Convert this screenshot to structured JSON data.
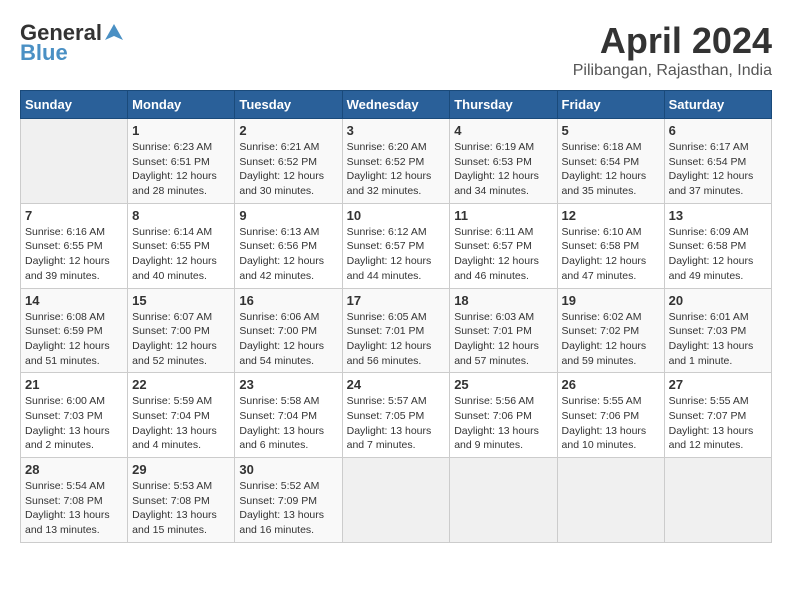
{
  "header": {
    "logo_general": "General",
    "logo_blue": "Blue",
    "title": "April 2024",
    "subtitle": "Pilibangan, Rajasthan, India"
  },
  "calendar": {
    "headers": [
      "Sunday",
      "Monday",
      "Tuesday",
      "Wednesday",
      "Thursday",
      "Friday",
      "Saturday"
    ],
    "weeks": [
      [
        {
          "day": "",
          "info": ""
        },
        {
          "day": "1",
          "info": "Sunrise: 6:23 AM\nSunset: 6:51 PM\nDaylight: 12 hours\nand 28 minutes."
        },
        {
          "day": "2",
          "info": "Sunrise: 6:21 AM\nSunset: 6:52 PM\nDaylight: 12 hours\nand 30 minutes."
        },
        {
          "day": "3",
          "info": "Sunrise: 6:20 AM\nSunset: 6:52 PM\nDaylight: 12 hours\nand 32 minutes."
        },
        {
          "day": "4",
          "info": "Sunrise: 6:19 AM\nSunset: 6:53 PM\nDaylight: 12 hours\nand 34 minutes."
        },
        {
          "day": "5",
          "info": "Sunrise: 6:18 AM\nSunset: 6:54 PM\nDaylight: 12 hours\nand 35 minutes."
        },
        {
          "day": "6",
          "info": "Sunrise: 6:17 AM\nSunset: 6:54 PM\nDaylight: 12 hours\nand 37 minutes."
        }
      ],
      [
        {
          "day": "7",
          "info": "Sunrise: 6:16 AM\nSunset: 6:55 PM\nDaylight: 12 hours\nand 39 minutes."
        },
        {
          "day": "8",
          "info": "Sunrise: 6:14 AM\nSunset: 6:55 PM\nDaylight: 12 hours\nand 40 minutes."
        },
        {
          "day": "9",
          "info": "Sunrise: 6:13 AM\nSunset: 6:56 PM\nDaylight: 12 hours\nand 42 minutes."
        },
        {
          "day": "10",
          "info": "Sunrise: 6:12 AM\nSunset: 6:57 PM\nDaylight: 12 hours\nand 44 minutes."
        },
        {
          "day": "11",
          "info": "Sunrise: 6:11 AM\nSunset: 6:57 PM\nDaylight: 12 hours\nand 46 minutes."
        },
        {
          "day": "12",
          "info": "Sunrise: 6:10 AM\nSunset: 6:58 PM\nDaylight: 12 hours\nand 47 minutes."
        },
        {
          "day": "13",
          "info": "Sunrise: 6:09 AM\nSunset: 6:58 PM\nDaylight: 12 hours\nand 49 minutes."
        }
      ],
      [
        {
          "day": "14",
          "info": "Sunrise: 6:08 AM\nSunset: 6:59 PM\nDaylight: 12 hours\nand 51 minutes."
        },
        {
          "day": "15",
          "info": "Sunrise: 6:07 AM\nSunset: 7:00 PM\nDaylight: 12 hours\nand 52 minutes."
        },
        {
          "day": "16",
          "info": "Sunrise: 6:06 AM\nSunset: 7:00 PM\nDaylight: 12 hours\nand 54 minutes."
        },
        {
          "day": "17",
          "info": "Sunrise: 6:05 AM\nSunset: 7:01 PM\nDaylight: 12 hours\nand 56 minutes."
        },
        {
          "day": "18",
          "info": "Sunrise: 6:03 AM\nSunset: 7:01 PM\nDaylight: 12 hours\nand 57 minutes."
        },
        {
          "day": "19",
          "info": "Sunrise: 6:02 AM\nSunset: 7:02 PM\nDaylight: 12 hours\nand 59 minutes."
        },
        {
          "day": "20",
          "info": "Sunrise: 6:01 AM\nSunset: 7:03 PM\nDaylight: 13 hours\nand 1 minute."
        }
      ],
      [
        {
          "day": "21",
          "info": "Sunrise: 6:00 AM\nSunset: 7:03 PM\nDaylight: 13 hours\nand 2 minutes."
        },
        {
          "day": "22",
          "info": "Sunrise: 5:59 AM\nSunset: 7:04 PM\nDaylight: 13 hours\nand 4 minutes."
        },
        {
          "day": "23",
          "info": "Sunrise: 5:58 AM\nSunset: 7:04 PM\nDaylight: 13 hours\nand 6 minutes."
        },
        {
          "day": "24",
          "info": "Sunrise: 5:57 AM\nSunset: 7:05 PM\nDaylight: 13 hours\nand 7 minutes."
        },
        {
          "day": "25",
          "info": "Sunrise: 5:56 AM\nSunset: 7:06 PM\nDaylight: 13 hours\nand 9 minutes."
        },
        {
          "day": "26",
          "info": "Sunrise: 5:55 AM\nSunset: 7:06 PM\nDaylight: 13 hours\nand 10 minutes."
        },
        {
          "day": "27",
          "info": "Sunrise: 5:55 AM\nSunset: 7:07 PM\nDaylight: 13 hours\nand 12 minutes."
        }
      ],
      [
        {
          "day": "28",
          "info": "Sunrise: 5:54 AM\nSunset: 7:08 PM\nDaylight: 13 hours\nand 13 minutes."
        },
        {
          "day": "29",
          "info": "Sunrise: 5:53 AM\nSunset: 7:08 PM\nDaylight: 13 hours\nand 15 minutes."
        },
        {
          "day": "30",
          "info": "Sunrise: 5:52 AM\nSunset: 7:09 PM\nDaylight: 13 hours\nand 16 minutes."
        },
        {
          "day": "",
          "info": ""
        },
        {
          "day": "",
          "info": ""
        },
        {
          "day": "",
          "info": ""
        },
        {
          "day": "",
          "info": ""
        }
      ]
    ]
  }
}
